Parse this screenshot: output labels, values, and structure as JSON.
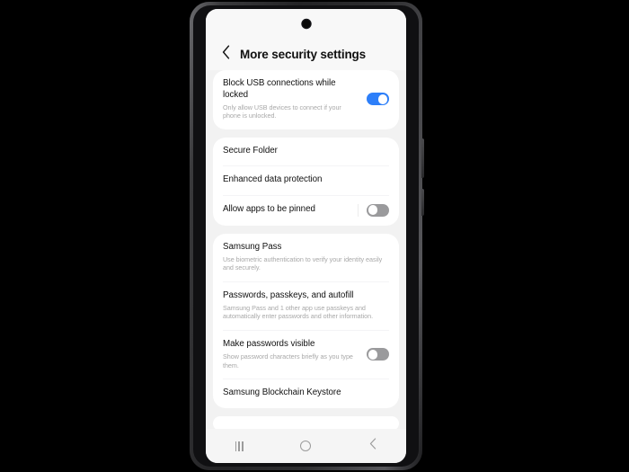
{
  "device": {
    "camera_icon": "front-camera-punch-hole",
    "side_buttons": [
      "volume-rocker",
      "power-button"
    ]
  },
  "appbar": {
    "back_icon": "chevron-left-icon",
    "title": "More security settings"
  },
  "sections": [
    {
      "name": "usb-section",
      "rows": [
        {
          "name": "block-usb-connections",
          "title": "Block USB connections while locked",
          "subtitle": "Only allow USB devices to connect if your phone is unlocked.",
          "control": "toggle",
          "toggle_state": "on",
          "divider_after": false
        }
      ]
    },
    {
      "name": "folder-section",
      "rows": [
        {
          "name": "secure-folder",
          "title": "Secure Folder",
          "subtitle": "",
          "control": "none",
          "toggle_state": "",
          "divider_after": true
        },
        {
          "name": "enhanced-data-protection",
          "title": "Enhanced data protection",
          "subtitle": "",
          "control": "none",
          "toggle_state": "",
          "divider_after": true
        },
        {
          "name": "allow-apps-to-be-pinned",
          "title": "Allow apps to be pinned",
          "subtitle": "",
          "control": "toggle-with-rule",
          "toggle_state": "off",
          "divider_after": false
        }
      ]
    },
    {
      "name": "passwords-section",
      "rows": [
        {
          "name": "samsung-pass",
          "title": "Samsung Pass",
          "subtitle": "Use biometric authentication to verify your identity easily and securely.",
          "control": "none",
          "toggle_state": "",
          "divider_after": true
        },
        {
          "name": "passwords-passkeys-autofill",
          "title": "Passwords, passkeys, and autofill",
          "subtitle": "Samsung Pass and 1 other app use passkeys and automatically enter passwords and other information.",
          "control": "none",
          "toggle_state": "",
          "divider_after": true
        },
        {
          "name": "make-passwords-visible",
          "title": "Make passwords visible",
          "subtitle": "Show password characters briefly as you type them.",
          "control": "toggle",
          "toggle_state": "off",
          "divider_after": true
        },
        {
          "name": "samsung-blockchain-keystore",
          "title": "Samsung Blockchain Keystore",
          "subtitle": "",
          "control": "none",
          "toggle_state": "",
          "divider_after": false
        }
      ]
    }
  ],
  "navbar": {
    "recents_icon": "recents-icon",
    "home_icon": "home-circle-icon",
    "back_icon": "back-chevron-icon"
  },
  "colors": {
    "accent": "#2d7ff9",
    "page_background": "#f2f2f2",
    "card_background": "#ffffff",
    "title_text": "#111111",
    "subtitle_text": "#a8a8a8",
    "toggle_off": "#9a9a9c"
  }
}
